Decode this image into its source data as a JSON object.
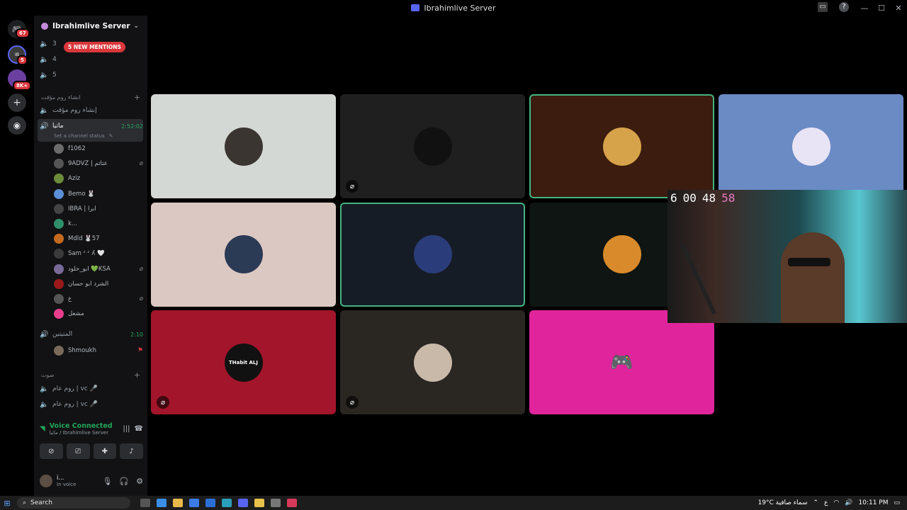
{
  "window": {
    "title": "Ibrahimlive Server"
  },
  "guilds": [
    {
      "name": "discord-home",
      "badge": "67",
      "color": "#5865f2"
    },
    {
      "name": "ibrahimlive-server",
      "badge": "5",
      "color": "#3a3a3a"
    },
    {
      "name": "server-3",
      "badge": "8K+",
      "color": "#6b3fa0"
    },
    {
      "name": "add-server",
      "badge": "",
      "color": "#2b2d31"
    },
    {
      "name": "discover",
      "badge": "",
      "color": "#2b2d31"
    }
  ],
  "server": {
    "name": "Ibrahimlive Server",
    "mentions": "5 NEW MENTIONS"
  },
  "top_channels": [
    "3",
    "4",
    "5"
  ],
  "category_temp": "انشاء روم مؤقت",
  "temp_channel": "إنشاء روم مؤقت",
  "active_channel": {
    "name": "ماتيا",
    "status": "Set a channel status",
    "timer": "2:52:02"
  },
  "voice_users": [
    {
      "name": "f1062",
      "color": "#6b6b6b",
      "muted": false
    },
    {
      "name": "9ADVZ | ﻋﺜﺎﺛﻢ",
      "color": "#555",
      "muted": true
    },
    {
      "name": "Aziz",
      "color": "#6c8b3b",
      "muted": false
    },
    {
      "name": "Bemo 🐰",
      "color": "#5b8fd6",
      "muted": false
    },
    {
      "name": "IBRA | ابرا",
      "color": "#444",
      "muted": false
    },
    {
      "name": "k...",
      "color": "#2f8f6a",
      "muted": false
    },
    {
      "name": "Mdld 🐰57",
      "color": "#c46a1e",
      "muted": false
    },
    {
      "name": "Sam ᶻ ᶻ ʎ 🤍",
      "color": "#3a3a3a",
      "muted": false
    },
    {
      "name": "ابو_خلود 💚KSA",
      "color": "#7a6a9a",
      "muted": true
    },
    {
      "name": "الشرد ابو حسان",
      "color": "#9a1a1a",
      "muted": false
    },
    {
      "name": "ع",
      "color": "#555",
      "muted": true
    },
    {
      "name": "مشعل",
      "color": "#e83e8c",
      "muted": false
    }
  ],
  "channel2": {
    "name": "المتيتين",
    "timer": "2:10"
  },
  "channel2_users": [
    {
      "name": "Shmoukh",
      "color": "#7a6a5a"
    }
  ],
  "category_voice": "صوت",
  "voice_channels": [
    "روم عام | ᴠᴄ 🎤",
    "روم عام | ᴠᴄ 🎤"
  ],
  "voice_connection": {
    "status": "Voice Connected",
    "location": "ماتيا / Ibrahimlive Server"
  },
  "current_user": {
    "name": "i...",
    "status": "In voice"
  },
  "tiles": [
    {
      "bg": "#d4d8d4",
      "pfp": "#3a3530",
      "label": "",
      "speaking": false,
      "muted": false
    },
    {
      "bg": "#1f1f1f",
      "pfp": "#111",
      "label": "",
      "speaking": false,
      "muted": true
    },
    {
      "bg": "#3b1c0f",
      "pfp": "#d6a24a",
      "label": "",
      "speaking": true,
      "muted": false
    },
    {
      "bg": "#6b8bc5",
      "pfp": "#e9e4f5",
      "label": "",
      "speaking": false,
      "muted": false
    },
    {
      "bg": "#dcc8c2",
      "pfp": "#2b3a55",
      "label": "",
      "speaking": false,
      "muted": false
    },
    {
      "bg": "#161c26",
      "pfp": "#2a3d7a",
      "label": "",
      "speaking": true,
      "muted": false
    },
    {
      "bg": "#0f1512",
      "pfp": "#d98a2a",
      "label": "",
      "speaking": false,
      "muted": false
    },
    {
      "bg": "#5f5f89",
      "pfp": "#7e8fa6",
      "label": "",
      "speaking": false,
      "muted": true
    },
    {
      "bg": "#a3152a",
      "pfp": "#111",
      "label": "THabit ALJ",
      "speaking": false,
      "muted": true
    },
    {
      "bg": "#2a2622",
      "pfp": "#c9b9a9",
      "label": "",
      "speaking": false,
      "muted": true
    },
    {
      "bg": "#e0259c",
      "pfp": "#e0259c",
      "label": "",
      "speaking": false,
      "muted": false
    }
  ],
  "webcam_countdown": {
    "days": "6",
    "hours": "00",
    "minutes": "48",
    "seconds": "58"
  },
  "taskbar": {
    "search": "Search",
    "weather": "19°C  سماء صافية",
    "time": "10:11 PM",
    "lang": "ع"
  }
}
